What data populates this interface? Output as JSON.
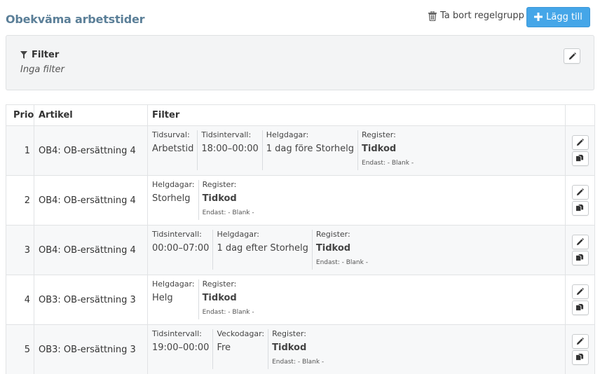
{
  "header": {
    "title": "Obekväma arbetstider",
    "delete_label": "Ta bort regelgrupp",
    "add_label": "Lägg till"
  },
  "filter_panel": {
    "title": "Filter",
    "subtitle": "Inga filter"
  },
  "table": {
    "columns": {
      "prio": "Prio",
      "artikel": "Artikel",
      "filter": "Filter"
    },
    "rows": [
      {
        "prio": "1",
        "artikel": "OB4: OB-ersättning 4",
        "conds": [
          {
            "label": "Tidsurval:",
            "value": "Arbetstid"
          },
          {
            "label": "Tidsintervall:",
            "value": "18:00–00:00"
          },
          {
            "label": "Helgdagar:",
            "value": "1 dag före Storhelg"
          },
          {
            "label": "Register:",
            "value": "Tidkod",
            "note": "Endast: - Blank -"
          }
        ]
      },
      {
        "prio": "2",
        "artikel": "OB4: OB-ersättning 4",
        "conds": [
          {
            "label": "Helgdagar:",
            "value": "Storhelg"
          },
          {
            "label": "Register:",
            "value": "Tidkod",
            "note": "Endast: - Blank -"
          }
        ]
      },
      {
        "prio": "3",
        "artikel": "OB4: OB-ersättning 4",
        "conds": [
          {
            "label": "Tidsintervall:",
            "value": "00:00–07:00"
          },
          {
            "label": "Helgdagar:",
            "value": "1 dag efter Storhelg"
          },
          {
            "label": "Register:",
            "value": "Tidkod",
            "note": "Endast: - Blank -"
          }
        ]
      },
      {
        "prio": "4",
        "artikel": "OB3: OB-ersättning 3",
        "conds": [
          {
            "label": "Helgdagar:",
            "value": "Helg"
          },
          {
            "label": "Register:",
            "value": "Tidkod",
            "note": "Endast: - Blank -"
          }
        ]
      },
      {
        "prio": "5",
        "artikel": "OB3: OB-ersättning 3",
        "conds": [
          {
            "label": "Tidsintervall:",
            "value": "19:00–00:00"
          },
          {
            "label": "Veckodagar:",
            "value": "Fre"
          },
          {
            "label": "Register:",
            "value": "Tidkod",
            "note": "Endast: - Blank -"
          }
        ]
      }
    ]
  },
  "icons": {
    "delete": "trash-icon",
    "add": "plus-icon",
    "filter": "funnel-icon",
    "edit": "pencil-icon",
    "copy": "copy-icon"
  },
  "colors": {
    "title": "#5b7f98",
    "primary_button": "#45a6e8",
    "panel_bg": "#f3f4f5"
  }
}
